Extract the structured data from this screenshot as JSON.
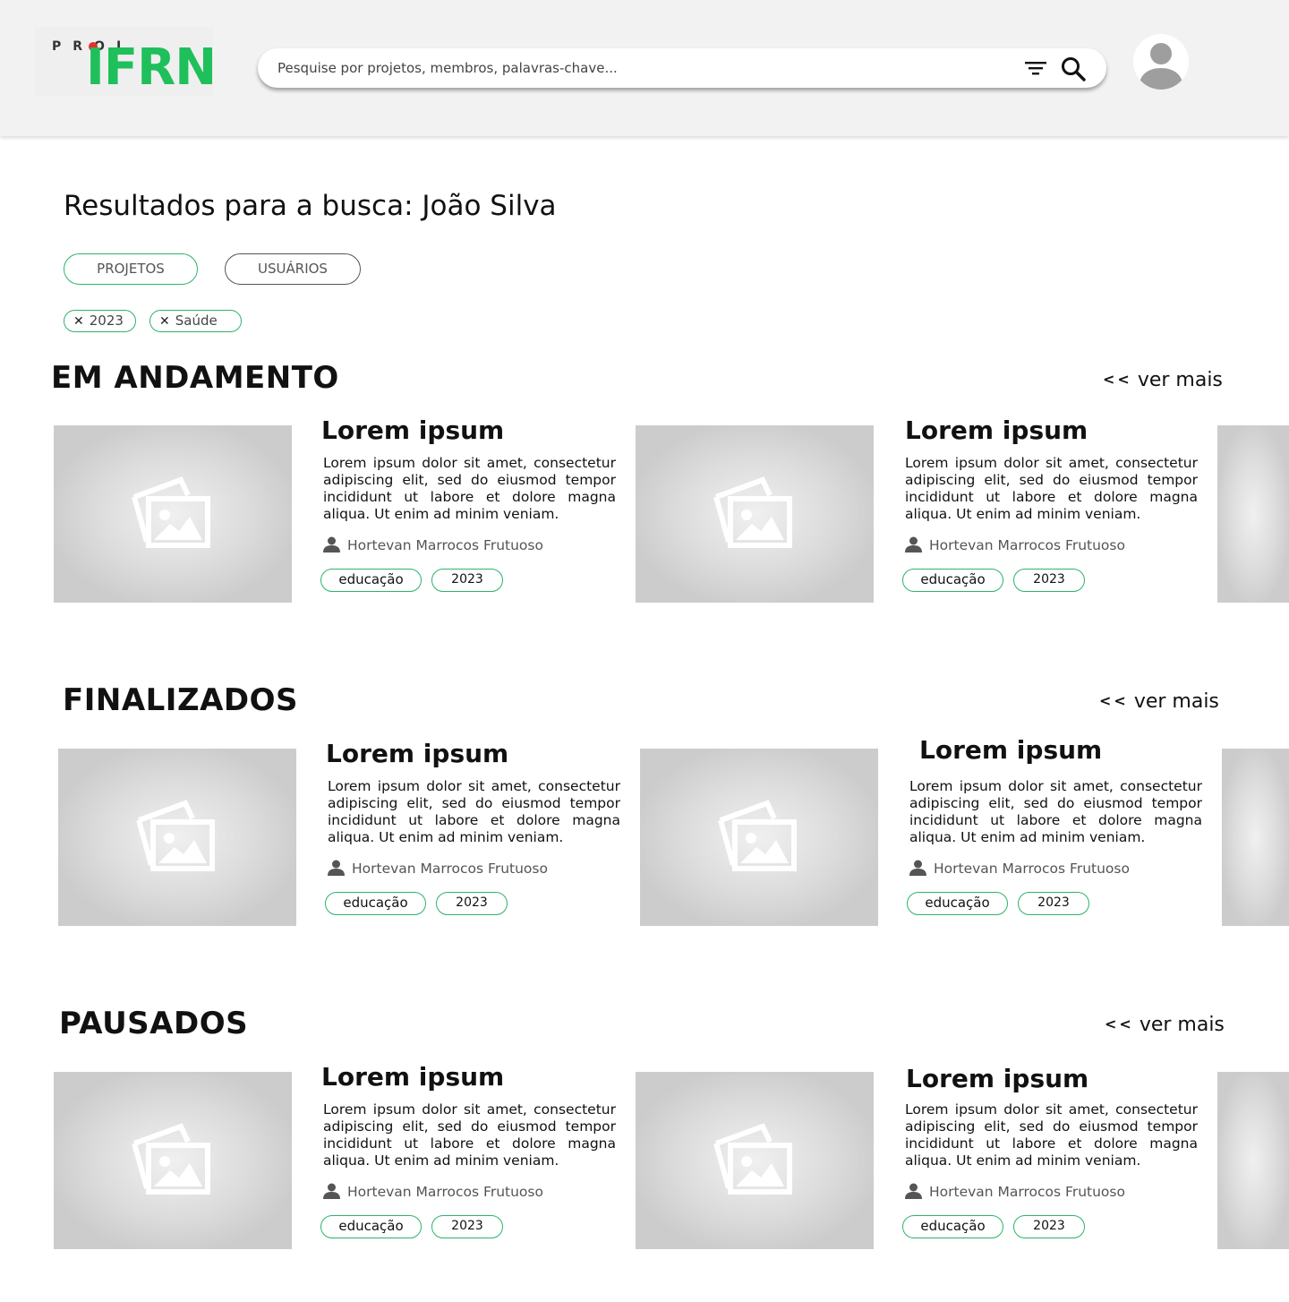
{
  "header": {
    "logo_small": "PROJ",
    "logo_main": "IFRN",
    "search_placeholder": "Pesquise por projetos, membros, palavras-chave..."
  },
  "page_title": "Resultados para a busca: João Silva",
  "tabs": [
    {
      "label": "PROJETOS"
    },
    {
      "label": "USUÁRIOS"
    }
  ],
  "active_filters": [
    {
      "label": "2023"
    },
    {
      "label": "Saúde"
    }
  ],
  "ver_mais_label": "ver mais",
  "ver_mais_arrows": "<<",
  "sections": [
    {
      "title": "EM  ANDAMENTO",
      "cards": [
        {
          "title": "Lorem ipsum",
          "description": "Lorem ipsum dolor sit amet, consectetur adipiscing elit, sed do eiusmod tempor incididunt ut labore et dolore magna aliqua. Ut enim ad minim veniam.",
          "author": "Hortevan Marrocos Frutuoso",
          "tags": [
            "educação",
            "2023"
          ]
        },
        {
          "title": "Lorem ipsum",
          "description": "Lorem ipsum dolor sit amet, consectetur adipiscing elit, sed do eiusmod tempor incididunt ut labore et dolore magna aliqua. Ut enim ad minim veniam.",
          "author": "Hortevan Marrocos Frutuoso",
          "tags": [
            "educação",
            "2023"
          ]
        }
      ]
    },
    {
      "title": "FINALIZADOS",
      "cards": [
        {
          "title": "Lorem ipsum",
          "description": "Lorem ipsum dolor sit amet, consectetur adipiscing elit, sed do eiusmod tempor incididunt ut labore et dolore magna aliqua. Ut enim ad minim veniam.",
          "author": "Hortevan Marrocos Frutuoso",
          "tags": [
            "educação",
            "2023"
          ]
        },
        {
          "title": "Lorem ipsum",
          "description": "Lorem ipsum dolor sit amet, consectetur adipiscing elit, sed do eiusmod tempor incididunt ut labore et dolore magna aliqua. Ut enim ad minim veniam.",
          "author": "Hortevan Marrocos Frutuoso",
          "tags": [
            "educação",
            "2023"
          ]
        }
      ]
    },
    {
      "title": "PAUSADOS",
      "cards": [
        {
          "title": "Lorem ipsum",
          "description": "Lorem ipsum dolor sit amet, consectetur adipiscing elit, sed do eiusmod tempor incididunt ut labore et dolore magna aliqua. Ut enim ad minim veniam.",
          "author": "Hortevan Marrocos Frutuoso",
          "tags": [
            "educação",
            "2023"
          ]
        },
        {
          "title": "Lorem ipsum",
          "description": "Lorem ipsum dolor sit amet, consectetur adipiscing elit, sed do eiusmod tempor incididunt ut labore et dolore magna aliqua. Ut enim ad minim veniam.",
          "author": "Hortevan Marrocos Frutuoso",
          "tags": [
            "educação",
            "2023"
          ]
        }
      ]
    }
  ],
  "colors": {
    "brand_green": "#1fbf5b",
    "brand_red": "#e5312b",
    "tag_border": "#2db36b",
    "header_bg": "#f2f2f2"
  },
  "icons": [
    "filter-icon",
    "search-icon",
    "avatar-icon",
    "close-icon",
    "image-placeholder-icon",
    "user-icon"
  ]
}
